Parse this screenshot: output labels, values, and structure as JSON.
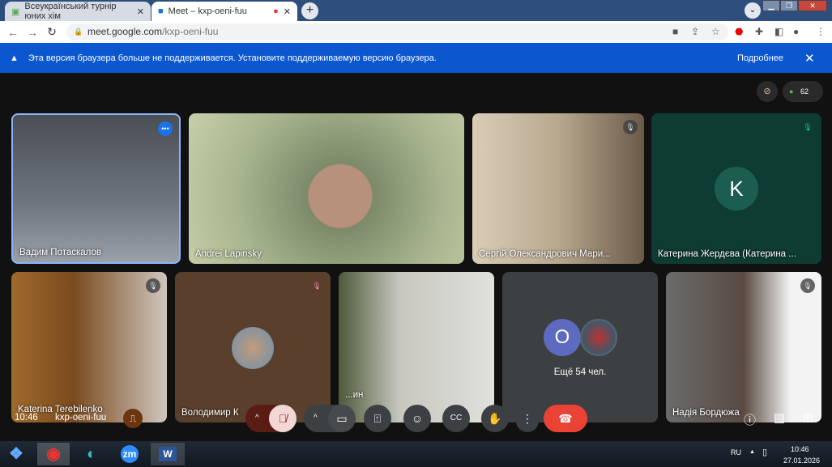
{
  "browser": {
    "tabs": [
      {
        "title": "Всеукраїнський турнір юних хім"
      },
      {
        "title": "Meet – kxp-oeni-fuu"
      }
    ],
    "url_host": "meet.google.com",
    "url_path": "/kxp-oeni-fuu"
  },
  "banner": {
    "message": "Эта версия браузера больше не поддерживается. Установите поддерживаемую версию браузера.",
    "more": "Подробнее"
  },
  "meet": {
    "participant_count": "62",
    "tiles": [
      {
        "name": "Вадим Потаскалов"
      },
      {
        "name": "Andrei Lapinsky"
      },
      {
        "name": "Сергій Олександрович Мари..."
      },
      {
        "name": "Катерина Жердєва (Катерина ...",
        "initial": "K"
      },
      {
        "name": "Katerina Terebilenko"
      },
      {
        "name": "Володимир К"
      },
      {
        "name": "...ин"
      },
      {
        "more": "Ещё 54 чел.",
        "initial": "O"
      },
      {
        "name": "Надія Бордюжа"
      }
    ],
    "time": "10:46",
    "meeting_code": "kxp-oeni-fuu"
  },
  "taskbar": {
    "lang": "RU",
    "time": "10:46",
    "date": "27.01.2026",
    "zoom_label": "zm",
    "word_label": "W"
  },
  "colors": {
    "banner": "#0b57d0",
    "end_call": "#ea4335",
    "speaking": "#8ab4f8"
  }
}
